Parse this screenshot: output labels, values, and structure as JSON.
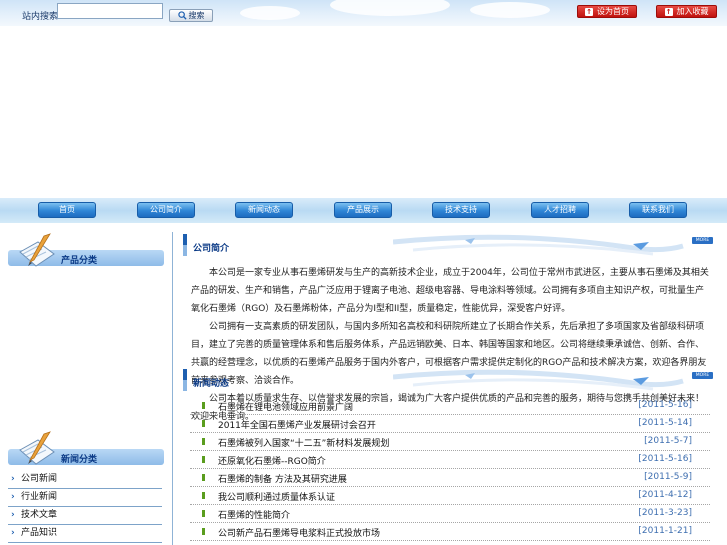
{
  "topbar": {
    "search_label": "站内搜索：",
    "search_value": "",
    "search_button": "搜索",
    "set_home": "设为首页",
    "add_favorite": "加入收藏"
  },
  "nav": {
    "items": [
      "首页",
      "公司简介",
      "新闻动态",
      "产品展示",
      "技术支持",
      "人才招聘",
      "联系我们"
    ]
  },
  "sidebar": {
    "box1_title": "产品分类",
    "box2_title": "新闻分类",
    "links": [
      "公司新闻",
      "行业新闻",
      "技术文章",
      "产品知识"
    ]
  },
  "about": {
    "title": "公司简介",
    "more": "MORE",
    "paragraphs": [
      "本公司是一家专业从事石墨烯研发与生产的高新技术企业，成立于2004年，公司位于常州市武进区，主要从事石墨烯及其相关产品的研发、生产和销售，产品广泛应用于锂离子电池、超级电容器、导电涂料等领域。公司拥有多项自主知识产权，可批量生产氧化石墨烯（RGO）及石墨烯粉体，产品分为I型和II型，质量稳定，性能优异，深受客户好评。",
      "公司拥有一支高素质的研发团队，与国内多所知名高校和科研院所建立了长期合作关系，先后承担了多项国家及省部级科研项目，建立了完善的质量管理体系和售后服务体系，产品远销欧美、日本、韩国等国家和地区。公司将继续秉承诚信、创新、合作、共赢的经营理念，以优质的石墨烯产品服务于国内外客户，可根据客户需求提供定制化的RGO产品和技术解决方案，欢迎各界朋友前来参观考察、洽谈合作。",
      "公司本着以质量求生存、以信誉求发展的宗旨，竭诚为广大客户提供优质的产品和完善的服务，期待与您携手共创美好未来！欢迎来电垂询。"
    ]
  },
  "news": {
    "title": "新闻动态",
    "more": "MORE",
    "items": [
      {
        "title": "石墨烯在锂电池领域应用前景广阔",
        "date": "[2011-5-16]"
      },
      {
        "title": "2011年全国石墨烯产业发展研讨会召开",
        "date": "[2011-5-14]"
      },
      {
        "title": "石墨烯被列入国家“十二五”新材料发展规划",
        "date": "[2011-5-7]"
      },
      {
        "title": "还原氧化石墨烯--RGO简介",
        "date": "[2011-5-16]"
      },
      {
        "title": "石墨烯的制备 方法及其研究进展",
        "date": "[2011-5-9]"
      },
      {
        "title": "我公司顺利通过质量体系认证",
        "date": "[2011-4-12]"
      },
      {
        "title": "石墨烯的性能简介",
        "date": "[2011-3-23]"
      },
      {
        "title": "公司新产品石墨烯导电浆料正式投放市场",
        "date": "[2011-1-21]"
      }
    ]
  },
  "colors": {
    "accent_blue": "#1d5fb0",
    "red_button": "#c0120f",
    "date_blue": "#3f6fb0",
    "tick_green": "#5a9d1e"
  }
}
